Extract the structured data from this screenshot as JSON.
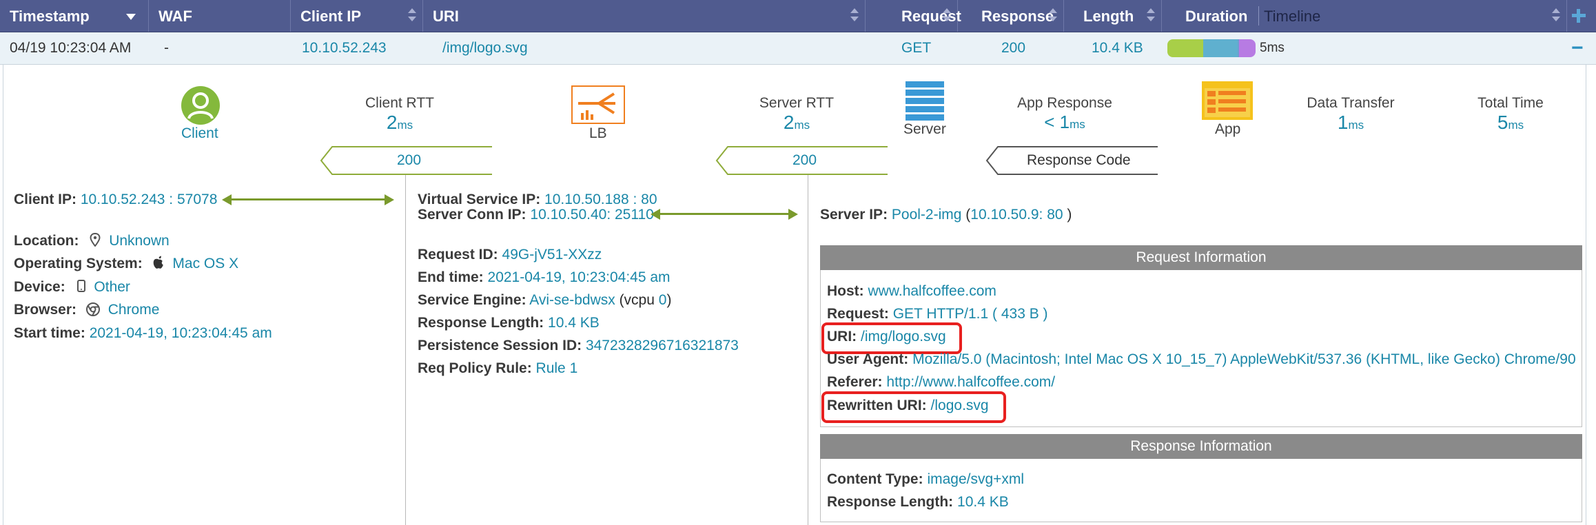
{
  "header": {
    "columns": [
      "Timestamp",
      "WAF",
      "Client IP",
      "URI",
      "Request",
      "Response",
      "Length",
      "Duration",
      "Timeline"
    ],
    "add_icon": "plus-icon"
  },
  "row": {
    "timestamp": "04/19 10:23:04 AM",
    "waf": "-",
    "client_ip": "10.10.52.243",
    "uri": "/img/logo.svg",
    "request": "GET",
    "response": "200",
    "length": "10.4 KB",
    "duration": "5ms",
    "collapse": "−",
    "timeline_colors": [
      "#a8cf48",
      "#5fb0cf",
      "#6d9fd0",
      "#b77be3"
    ]
  },
  "flow": {
    "client": "Client",
    "lb": "LB",
    "server": "Server",
    "app": "App",
    "client_rtt": {
      "label": "Client RTT",
      "value": "2",
      "unit": "ms"
    },
    "server_rtt": {
      "label": "Server RTT",
      "value": "2",
      "unit": "ms"
    },
    "app_response": {
      "label": "App Response",
      "value": "< 1",
      "unit": "ms"
    },
    "data_transfer": {
      "label": "Data Transfer",
      "value": "1",
      "unit": "ms"
    },
    "total_time": {
      "label": "Total Time",
      "value": "5",
      "unit": "ms"
    },
    "code1": "200",
    "code2": "200",
    "response_code_label": "Response Code"
  },
  "client_info": {
    "client_ip_label": "Client IP:",
    "client_ip_value": "10.10.52.243 : 57078",
    "location_label": "Location:",
    "location_value": "Unknown",
    "os_label": "Operating System:",
    "os_value": "Mac OS X",
    "device_label": "Device:",
    "device_value": "Other",
    "browser_label": "Browser:",
    "browser_value": "Chrome",
    "start_label": "Start time:",
    "start_value": "2021-04-19, 10:23:04:45 am"
  },
  "lb_info": {
    "vs_ip_label": "Virtual Service IP:",
    "vs_ip_value": "10.10.50.188 : 80",
    "conn_ip_label": "Server Conn IP:",
    "conn_ip_value": "10.10.50.40: 25110",
    "request_id_label": "Request ID:",
    "request_id_value": "49G-jV51-XXzz",
    "end_time_label": "End time:",
    "end_time_value": "2021-04-19, 10:23:04:45 am",
    "se_label": "Service Engine:",
    "se_value": "Avi-se-bdwsx",
    "se_vcpu_prefix": " (vcpu ",
    "se_vcpu": "0",
    "se_vcpu_suffix": ")",
    "resp_len_label": "Response Length:",
    "resp_len_value": "10.4 KB",
    "persist_label": "Persistence Session ID:",
    "persist_value": "3472328296716321873",
    "policy_label": "Req Policy Rule:",
    "policy_value": "Rule 1"
  },
  "server_info": {
    "server_ip_label": "Server IP:",
    "server_pool": "Pool-2-img",
    "server_addr_open": " (",
    "server_addr": "10.10.50.9: 80",
    "server_addr_close": " )",
    "request_header": "Request Information",
    "host_label": "Host:",
    "host_value": "www.halfcoffee.com",
    "request_label": "Request:",
    "request_value": "GET HTTP/1.1 ( 433 B )",
    "uri_label": "URI:",
    "uri_value": "/img/logo.svg",
    "ua_label": "User Agent:",
    "ua_value": "Mozilla/5.0 (Macintosh; Intel Mac OS X 10_15_7) AppleWebKit/537.36 (KHTML, like Gecko) Chrome/90",
    "referer_label": "Referer:",
    "referer_value": "http://www.halfcoffee.com/",
    "rewritten_label": "Rewritten URI:",
    "rewritten_value": "/logo.svg",
    "response_header": "Response Information",
    "ctype_label": "Content Type:",
    "ctype_value": "image/svg+xml",
    "resp_len_label": "Response Length:",
    "resp_len_value": "10.4 KB"
  }
}
